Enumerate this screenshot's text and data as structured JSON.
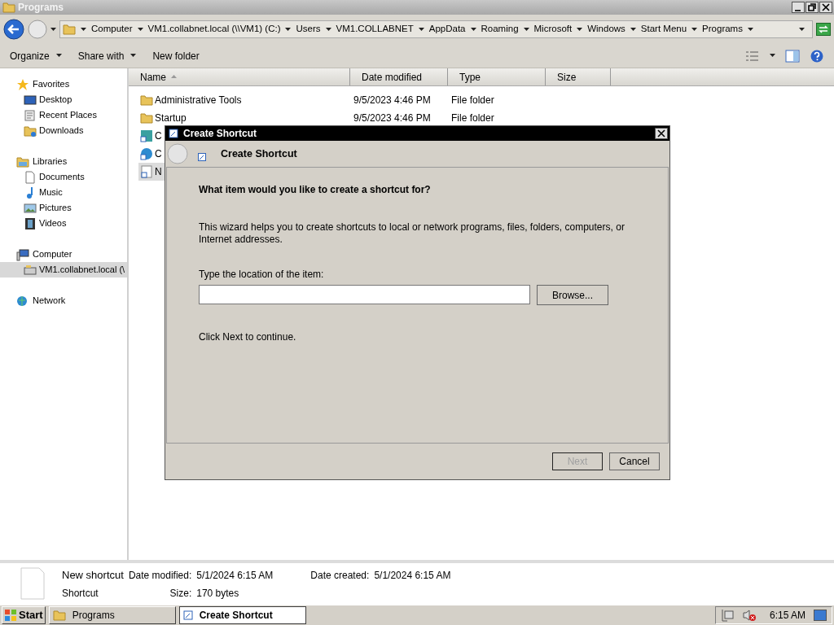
{
  "window": {
    "title": "Programs"
  },
  "breadcrumb": [
    "Computer",
    "VM1.collabnet.local (\\\\VM1) (C:)",
    "Users",
    "VM1.COLLABNET",
    "AppData",
    "Roaming",
    "Microsoft",
    "Windows",
    "Start Menu",
    "Programs"
  ],
  "toolbar": [
    {
      "label": "Organize",
      "dropdown": true
    },
    {
      "label": "Share with",
      "dropdown": true
    },
    {
      "label": "New folder",
      "dropdown": false
    }
  ],
  "nav": [
    {
      "label": "Favorites",
      "selected": false,
      "children": [
        {
          "label": "Desktop",
          "selected": false
        },
        {
          "label": "Recent Places",
          "selected": false
        },
        {
          "label": "Downloads",
          "selected": false
        }
      ]
    },
    {
      "label": "Libraries",
      "selected": false,
      "children": [
        {
          "label": "Documents",
          "selected": false
        },
        {
          "label": "Music",
          "selected": false
        },
        {
          "label": "Pictures",
          "selected": false
        },
        {
          "label": "Videos",
          "selected": false
        }
      ]
    },
    {
      "label": "Computer",
      "selected": false,
      "children": [
        {
          "label": "VM1.collabnet.local (\\",
          "selected": true
        }
      ]
    },
    {
      "label": "Network",
      "selected": false
    }
  ],
  "columns": [
    {
      "label": "Name",
      "sorted": true
    },
    {
      "label": "Date modified",
      "sorted": false
    },
    {
      "label": "Type",
      "sorted": false
    },
    {
      "label": "Size",
      "sorted": false
    }
  ],
  "files": [
    {
      "kind": "folder",
      "name": "Administrative Tools",
      "date": "9/5/2023 4:46 PM",
      "type": "File folder",
      "selected": false
    },
    {
      "kind": "folder",
      "name": "Startup",
      "date": "9/5/2023 4:46 PM",
      "type": "File folder",
      "selected": false
    },
    {
      "kind": "app",
      "name": "C",
      "selected": false
    },
    {
      "kind": "web",
      "name": "C",
      "selected": false
    },
    {
      "kind": "shortcut",
      "name": "N",
      "selected": true
    }
  ],
  "dialog": {
    "title": "Create Shortcut",
    "heading": "Create Shortcut",
    "question": "What item would you like to create a shortcut for?",
    "description": "This wizard helps you to create shortcuts to local or network programs, files, folders, computers, or Internet addresses.",
    "field_label": "Type the location of the item:",
    "browse": "Browse...",
    "hint": "Click Next to continue.",
    "buttons": [
      {
        "label": "Next",
        "disabled": true
      },
      {
        "label": "Cancel",
        "disabled": false
      }
    ]
  },
  "details": {
    "name": "New shortcut",
    "type": "Shortcut",
    "fields": [
      {
        "label": "Date modified:",
        "value": "5/1/2024 6:15 AM"
      },
      {
        "label": "Date created:",
        "value": "5/1/2024 6:15 AM"
      },
      {
        "label": "Size:",
        "value": "170 bytes"
      }
    ]
  },
  "taskbar": {
    "start": "Start",
    "items": [
      {
        "label": "Programs",
        "selected": false
      },
      {
        "label": "Create Shortcut",
        "selected": true
      }
    ],
    "clock": "6:15 AM"
  }
}
